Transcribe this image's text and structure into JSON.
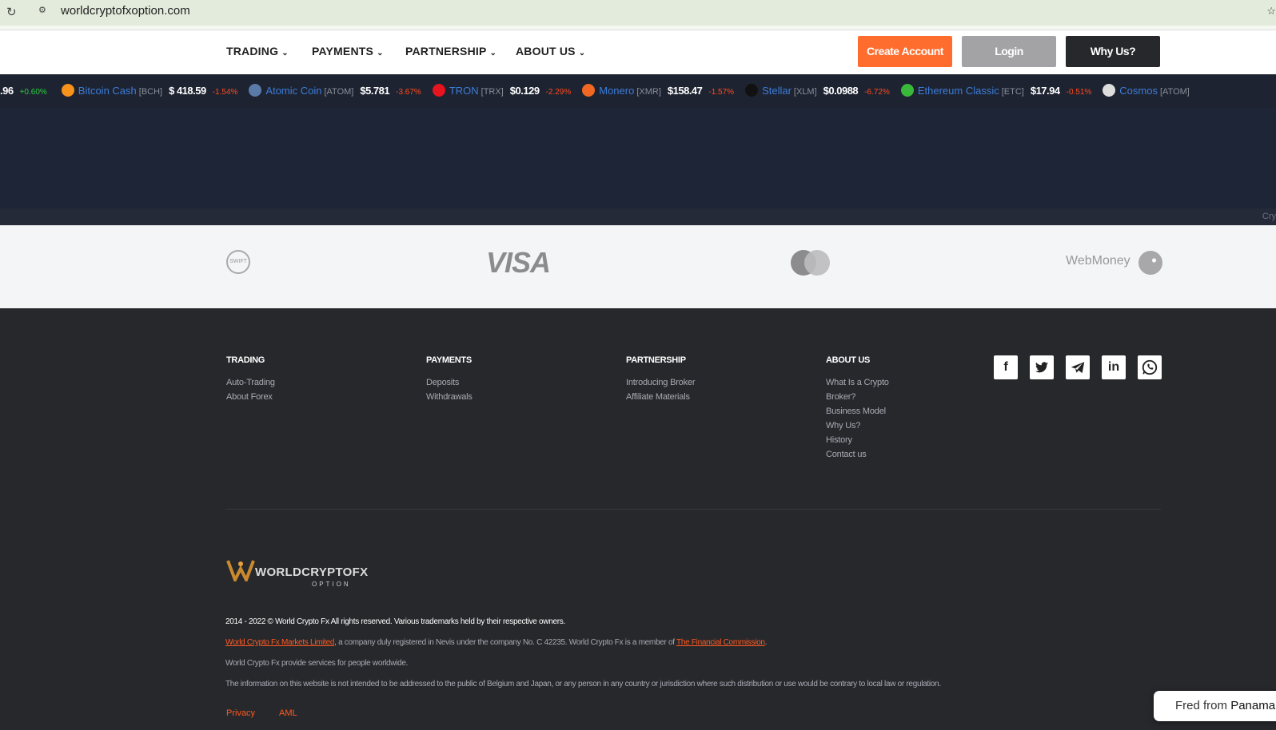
{
  "browser": {
    "url": "worldcryptofxoption.com"
  },
  "nav": {
    "items": [
      "TRADING",
      "PAYMENTS",
      "PARTNERSHIP",
      "ABOUT US"
    ],
    "create_account": "Create Account",
    "login": "Login",
    "why_us": "Why Us?"
  },
  "ticker": [
    {
      "name": "",
      "symbol": "",
      "price": ".96",
      "change": "+0.60%",
      "up": true,
      "color": ""
    },
    {
      "name": "Bitcoin Cash",
      "symbol": "[BCH]",
      "price": "$ 418.59",
      "change": "-1.54%",
      "up": false,
      "color": "#f7931a"
    },
    {
      "name": "Atomic Coin",
      "symbol": "[ATOM]",
      "price": "$5.781",
      "change": "-3.67%",
      "up": false,
      "color": "#5a7aa8"
    },
    {
      "name": "TRON",
      "symbol": "[TRX]",
      "price": "$0.129",
      "change": "-2.29%",
      "up": false,
      "color": "#e5141f"
    },
    {
      "name": "Monero",
      "symbol": "[XMR]",
      "price": "$158.47",
      "change": "-1.57%",
      "up": false,
      "color": "#f26822"
    },
    {
      "name": "Stellar",
      "symbol": "[XLM]",
      "price": "$0.0988",
      "change": "-6.72%",
      "up": false,
      "color": "#111111"
    },
    {
      "name": "Ethereum Classic",
      "symbol": "[ETC]",
      "price": "$17.94",
      "change": "-0.51%",
      "up": false,
      "color": "#3ab83a"
    },
    {
      "name": "Cosmos",
      "symbol": "[ATOM]",
      "price": "",
      "change": "",
      "up": false,
      "color": "#dddddd"
    }
  ],
  "hero_caption": "Cry",
  "payments": {
    "swift": "SWIFT",
    "visa": "VISA",
    "webmoney": "WebMoney"
  },
  "footer": {
    "columns": [
      {
        "title": "TRADING",
        "links": [
          "Auto-Trading",
          "About Forex"
        ]
      },
      {
        "title": "PAYMENTS",
        "links": [
          "Deposits",
          "Withdrawals"
        ]
      },
      {
        "title": "PARTNERSHIP",
        "links": [
          "Introducing Broker",
          "Affiliate Materials"
        ]
      },
      {
        "title": "ABOUT US",
        "links": [
          "What Is a Crypto",
          "Broker?",
          "Business Model",
          "Why Us?",
          "History",
          "Contact us"
        ]
      }
    ],
    "social": [
      "f",
      "t",
      "tg",
      "in",
      "wa"
    ],
    "logo": {
      "main": "WORLDCRYPTOFX",
      "sub": "OPTION"
    },
    "copyright": "2014 - 2022 © World Crypto Fx All rights reserved. Various trademarks held by their respective owners.",
    "company_link": "World Crypto Fx Markets Limited",
    "company_text": ", a company duly registered in Nevis under the company No. C 42235. World Crypto Fx is a member of ",
    "commission_link": "The Financial Commission",
    "period": ".",
    "services": "World Crypto Fx provide services for people worldwide.",
    "disclaimer": "The information on this website is not intended to be addressed to the public of Belgium and Japan, or any person in any country or jurisdiction where such distribution or use would be contrary to local law or regulation.",
    "privacy": "Privacy",
    "aml": "AML"
  },
  "toast": {
    "prefix": "Fred from ",
    "place": "Panama"
  },
  "colors": {
    "accent": "#ff6d2e",
    "up": "#2ecc40",
    "down": "#ff4a1c"
  }
}
